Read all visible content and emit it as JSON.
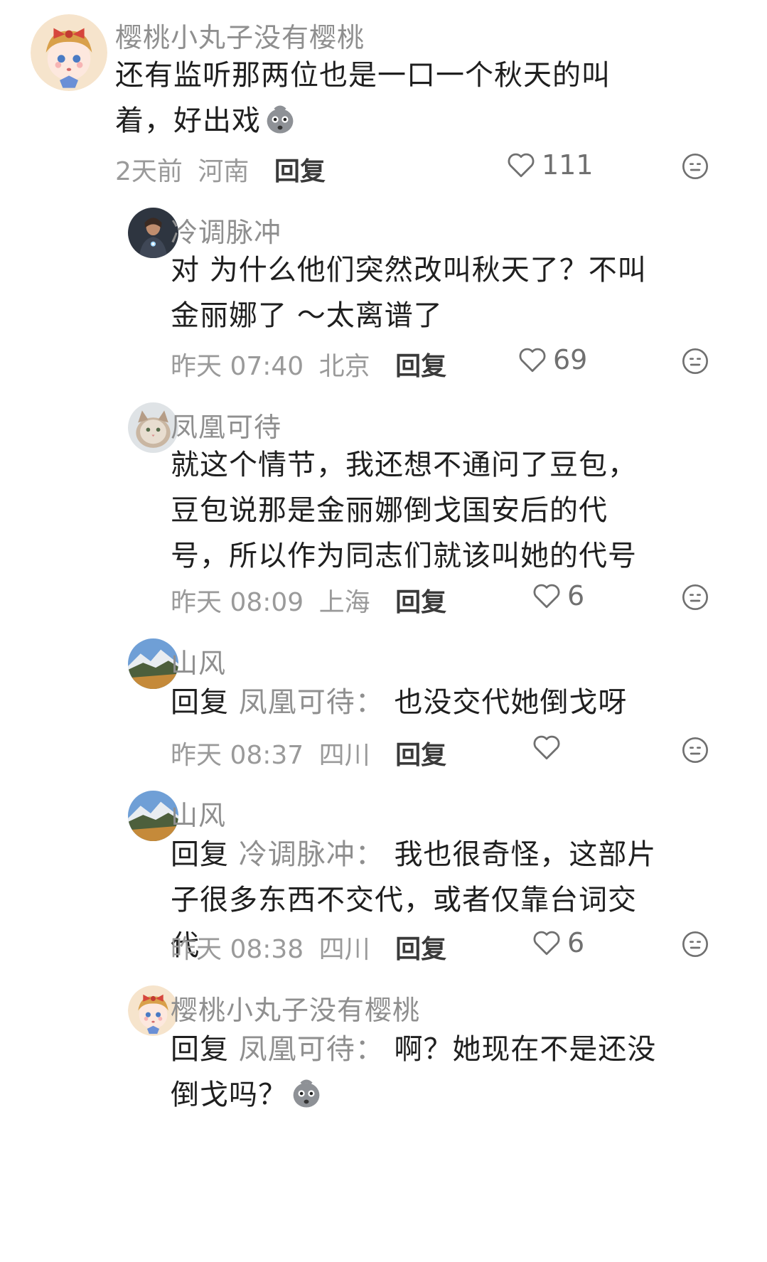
{
  "comments": [
    {
      "user": "樱桃小丸子没有樱桃",
      "text": "还有监听那两位也是一口一个秋天的叫着，好出戏",
      "time": "2天前",
      "location": "河南",
      "reply_label": "回复",
      "likes": "111"
    },
    {
      "user": "冷调脉冲",
      "text": "对 为什么他们突然改叫秋天了？不叫金丽娜了 ～太离谱了",
      "time": "昨天 07:40",
      "location": "北京",
      "reply_label": "回复",
      "likes": "69"
    },
    {
      "user": "凤凰可待",
      "text": "就这个情节，我还想不通问了豆包，豆包说那是金丽娜倒戈国安后的代号，所以作为同志们就该叫她的代号",
      "time": "昨天 08:09",
      "location": "上海",
      "reply_label": "回复",
      "likes": "6"
    },
    {
      "user": "山风",
      "reply_prefix": "回复",
      "reply_target": "凤凰可待：",
      "text": "也没交代她倒戈呀",
      "time": "昨天 08:37",
      "location": "四川",
      "reply_label": "回复",
      "likes": ""
    },
    {
      "user": "山风",
      "reply_prefix": "回复",
      "reply_target": "冷调脉冲：",
      "text": "我也很奇怪，这部片子很多东西不交代，或者仅靠台词交代",
      "time": "昨天 08:38",
      "location": "四川",
      "reply_label": "回复",
      "likes": "6"
    },
    {
      "user": "樱桃小丸子没有樱桃",
      "reply_prefix": "回复",
      "reply_target": "凤凰可待：",
      "text": "啊？她现在不是还没倒戈吗？",
      "time": "",
      "location": "",
      "reply_label": "",
      "likes": ""
    }
  ],
  "icons": {
    "like": "heart-outline-icon",
    "react": "emoji-face-icon",
    "inline_emoji": "shocked-blob-emoji"
  },
  "colors": {
    "name": "#8f8f8f",
    "text": "#1f1f1f",
    "meta": "#9a9a9a"
  }
}
